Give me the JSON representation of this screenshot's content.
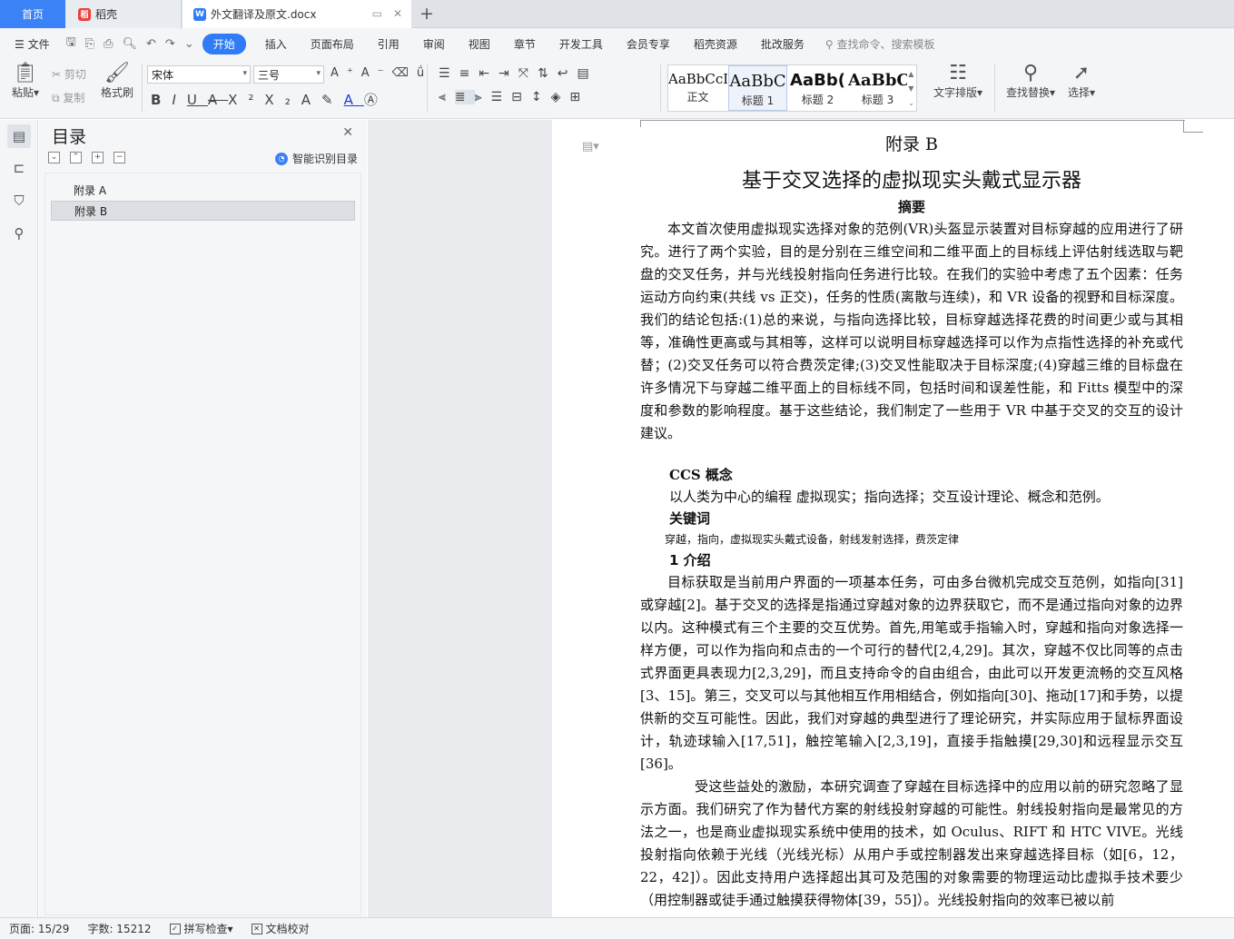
{
  "tabs": {
    "home": "首页",
    "daoke": "稻壳",
    "doc": "外文翻译及原文.docx"
  },
  "menu": {
    "file": "文件",
    "items": [
      "开始",
      "插入",
      "页面布局",
      "引用",
      "审阅",
      "视图",
      "章节",
      "开发工具",
      "会员专享",
      "稻壳资源",
      "批改服务"
    ],
    "search": "查找命令、搜索模板"
  },
  "ribbon": {
    "paste": "粘贴",
    "cut": "剪切",
    "copy": "复制",
    "format_painter": "格式刷",
    "font_name": "宋体",
    "font_size": "三号",
    "styles": [
      {
        "preview": "AaBbCcI",
        "label": "正文"
      },
      {
        "preview": "AaBbC",
        "label": "标题 1"
      },
      {
        "preview": "AaBb(",
        "label": "标题 2"
      },
      {
        "preview": "AaBbC",
        "label": "标题 3"
      }
    ],
    "text_layout": "文字排版",
    "find_replace": "查找替换",
    "select": "选择"
  },
  "toc": {
    "title": "目录",
    "smart": "智能识别目录",
    "items": [
      "附录 A",
      "附录 B"
    ],
    "selected": 1
  },
  "doc": {
    "appendix": "附录 B",
    "title": "基于交叉选择的虚拟现实头戴式显示器",
    "abstract_heading": "摘要",
    "abstract": "本文首次使用虚拟现实选择对象的范例(VR)头盔显示装置对目标穿越的应用进行了研究。进行了两个实验，目的是分别在三维空间和二维平面上的目标线上评估射线选取与靶盘的交叉任务，并与光线投射指向任务进行比较。在我们的实验中考虑了五个因素：任务运动方向约束(共线 vs 正交)，任务的性质(离散与连续)，和 VR 设备的视野和目标深度。我们的结论包括:(1)总的来说，与指向选择比较，目标穿越选择花费的时间更少或与其相等，准确性更高或与其相等，这样可以说明目标穿越选择可以作为点指性选择的补充或代替；(2)交叉任务可以符合费茨定律;(3)交叉性能取决于目标深度;(4)穿越三维的目标盘在许多情况下与穿越二维平面上的目标线不同，包括时间和误差性能，和 Fitts 模型中的深度和参数的影响程度。基于这些结论，我们制定了一些用于 VR 中基于交叉的交互的设计建议。",
    "ccs_heading": "CCS 概念",
    "ccs_text": "以人类为中心的编程       虚拟现实；指向选择；交互设计理论、概念和范例。",
    "keywords_heading": "关键词",
    "keywords_text": "穿越，指向，虚拟现实头戴式设备，射线发射选择，费茨定律",
    "intro_heading": "1  介绍",
    "intro_p1": "目标获取是当前用户界面的一项基本任务，可由多台微机完成交互范例，如指向[31]或穿越[2]。基于交叉的选择是指通过穿越对象的边界获取它，而不是通过指向对象的边界以内。这种模式有三个主要的交互优势。首先,用笔或手指输入时，穿越和指向对象选择一样方便，可以作为指向和点击的一个可行的替代[2,4,29]。其次，穿越不仅比同等的点击式界面更具表现力[2,3,29]，而且支持命令的自由组合，由此可以开发更流畅的交互风格[3、15]。第三，交叉可以与其他相互作用相结合，例如指向[30]、拖动[17]和手势，以提供新的交互可能性。因此，我们对穿越的典型进行了理论研究，并实际应用于鼠标界面设计，轨迹球输入[17,51]，触控笔输入[2,3,19]，直接手指触摸[29,30]和远程显示交互[36]。",
    "intro_p2": "受这些益处的激励，本研究调查了穿越在目标选择中的应用以前的研究忽略了显示方面。我们研究了作为替代方案的射线投射穿越的可能性。射线投射指向是最常见的方法之一，也是商业虚拟现实系统中使用的技术，如 Oculus、RIFT 和 HTC VIVE。光线投射指向依赖于光线（光线光标）从用户手或控制器发出来穿越选择目标（如[6，12，22，42]）。因此支持用户选择超出其可及范围的对象需要的物理运动比虚拟手技术要少（用控制器或徒手通过触摸获得物体[39，55]）。光线投射指向的效率已被以前"
  },
  "status": {
    "page": "页面: 15/29",
    "words": "字数: 15212",
    "spell": "拼写检查",
    "proof": "文档校对"
  }
}
